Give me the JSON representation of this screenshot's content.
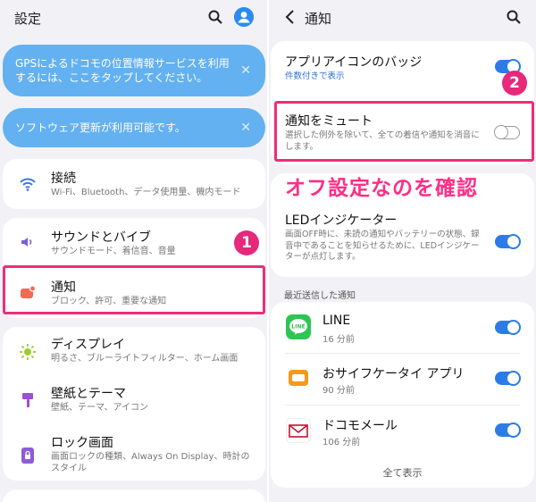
{
  "left": {
    "title": "設定",
    "banners": [
      {
        "text": "GPSによるドコモの位置情報サービスを利用するには、ここをタップしてください。",
        "close": "✕"
      },
      {
        "text": "ソフトウェア更新が利用可能です。",
        "close": "✕"
      }
    ],
    "connection": {
      "title": "接続",
      "sub": "Wi-Fi、Bluetooth、データ使用量、機内モード"
    },
    "sound": {
      "title": "サウンドとバイブ",
      "sub": "サウンドモード、着信音、音量"
    },
    "notifications": {
      "title": "通知",
      "sub": "ブロック、許可、重要な通知"
    },
    "display": {
      "title": "ディスプレイ",
      "sub": "明るさ、ブルーライトフィルター、ホーム画面"
    },
    "wallpaper": {
      "title": "壁紙とテーマ",
      "sub": "壁紙、テーマ、アイコン"
    },
    "lockscreen": {
      "title": "ロック画面",
      "sub": "画面ロックの種類、Always On Display、時計のスタイル"
    }
  },
  "right": {
    "title": "通知",
    "badge_row": {
      "title": "アプリアイコンのバッジ",
      "sub": "件数付きで表示",
      "toggle": true
    },
    "mute_row": {
      "title": "通知をミュート",
      "sub": "選択した例外を除いて、全ての着信や通知を消音にします。",
      "toggle": false
    },
    "led_row": {
      "title": "LEDインジケーター",
      "sub": "画面OFF時に、未読の通知やバッテリーの状態、録音中であることを知らせるために、LEDインジケーターが点灯します。",
      "toggle": true
    },
    "recent_label": "最近送信した通知",
    "apps": [
      {
        "name": "LINE",
        "count": "16 分前",
        "toggle": true,
        "icon": "line-icon"
      },
      {
        "name": "おサイフケータイ アプリ",
        "count": "90 分前",
        "toggle": true,
        "icon": "osaifu-icon"
      },
      {
        "name": "ドコモメール",
        "count": "106 分前",
        "toggle": true,
        "icon": "docomo-mail-icon"
      }
    ],
    "show_all": "全て表示"
  },
  "annotations": {
    "step1": "1",
    "step2": "2",
    "overlay": "オフ設定なのを確認"
  },
  "colors": {
    "accent": "#ee2d78",
    "toggle_on": "#2b7ce8",
    "banner": "#63b1f0"
  }
}
